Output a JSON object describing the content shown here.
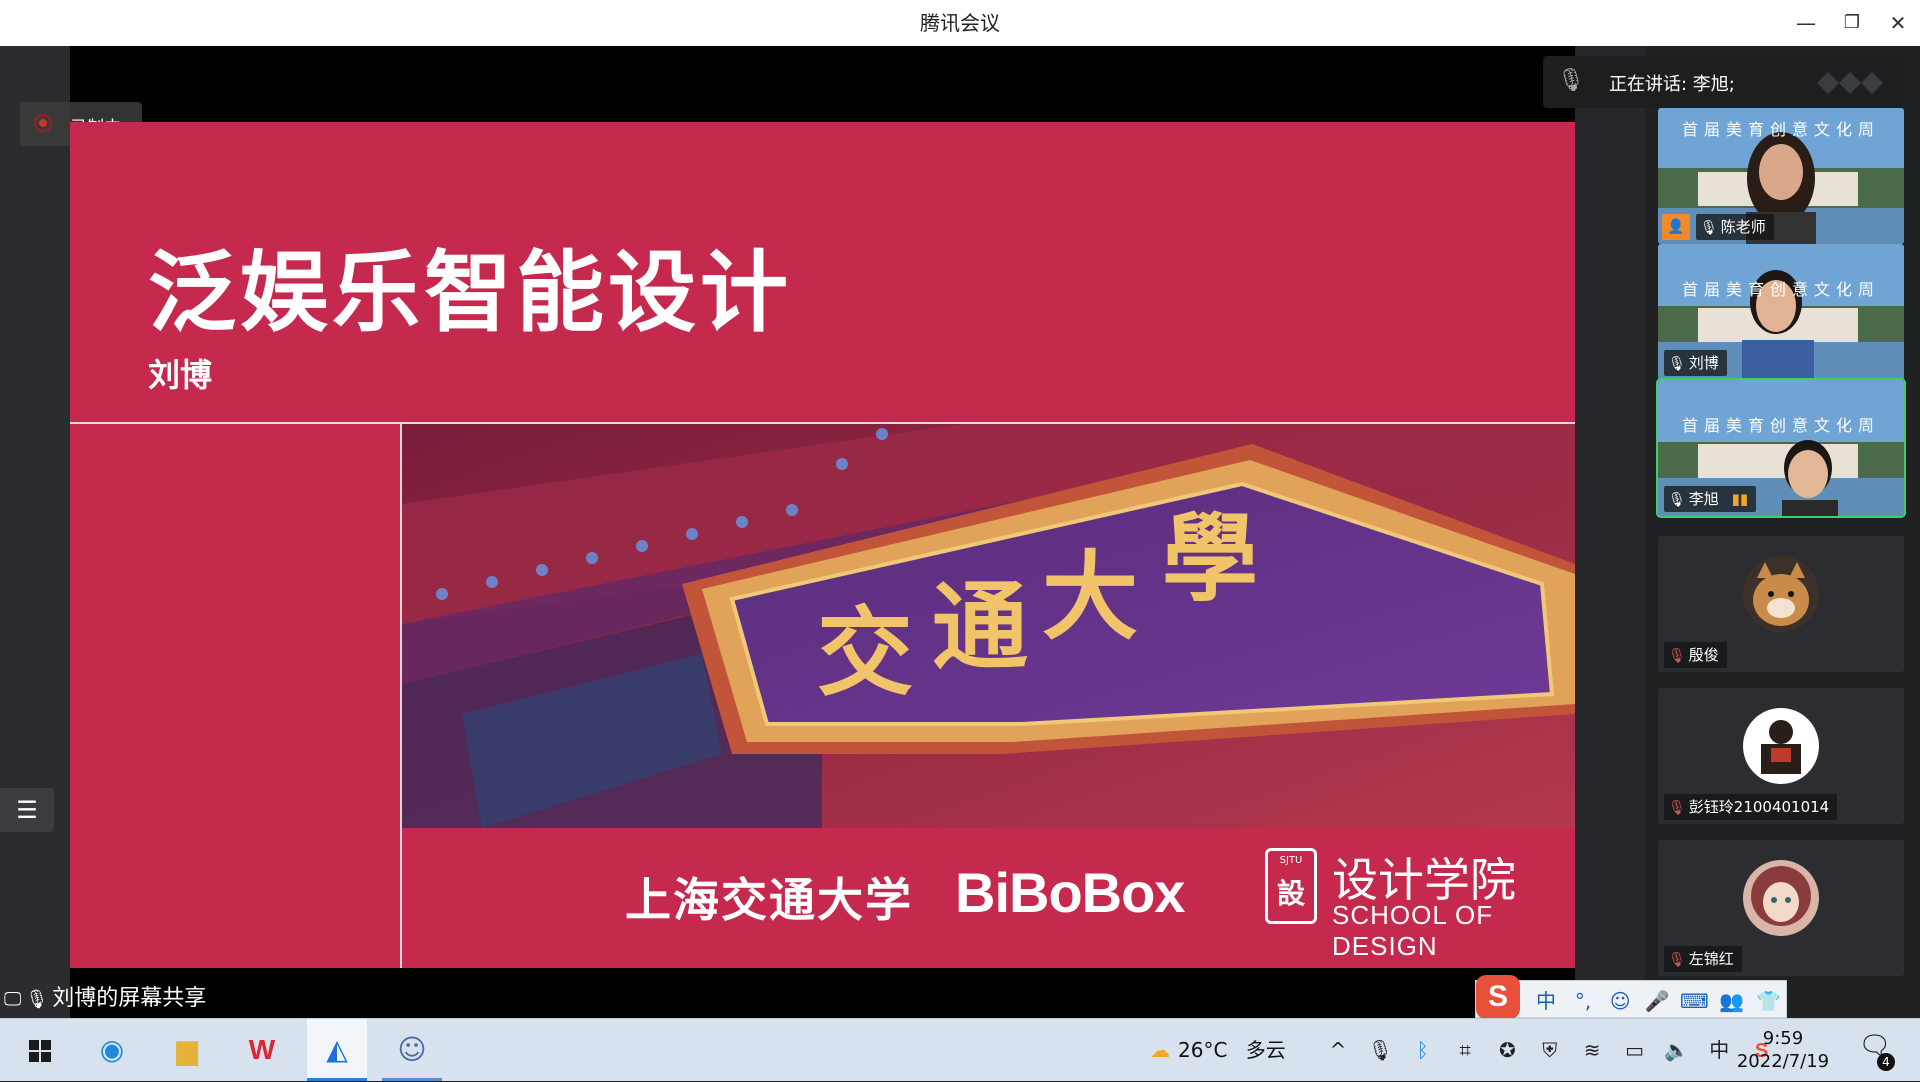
{
  "window": {
    "title": "腾讯会议"
  },
  "recording": {
    "label": "录制中"
  },
  "slide": {
    "title": "泛娱乐智能设计",
    "author": "刘博",
    "plaque_chars": [
      "交",
      "通",
      "大",
      "學"
    ],
    "logo_sjtu": "上海交通大学",
    "logo_bibobox": "BiBoBox",
    "logo_seal_top": "SJTU",
    "logo_seal_mid": "設",
    "logo_design_cn": "设计学院",
    "logo_design_en": "SCHOOL OF DESIGN"
  },
  "share": {
    "label": "刘博的屏幕共享"
  },
  "speaking": {
    "label": "正在讲话: 李旭;"
  },
  "participants": [
    {
      "name": "陈老师",
      "mic": "on",
      "type": "video"
    },
    {
      "name": "刘博",
      "mic": "on",
      "type": "video"
    },
    {
      "name": "李旭",
      "mic": "on",
      "type": "video",
      "active": true
    },
    {
      "name": "殷俊",
      "mic": "off",
      "type": "avatar"
    },
    {
      "name": "彭钰玲2100401014",
      "mic": "off",
      "type": "avatar"
    },
    {
      "name": "左锦红",
      "mic": "off",
      "type": "avatar"
    }
  ],
  "banner_text": "首届美育创意文化周",
  "ime": {
    "items": [
      "中",
      "°,",
      "☺",
      "🎤",
      "⌨",
      "👥",
      "👕",
      "▦"
    ]
  },
  "taskbar": {
    "weather_temp": "26°C",
    "weather_desc": "多云",
    "tray_ime": "中",
    "time": "9:59",
    "date": "2022/7/19",
    "notification_count": "4"
  },
  "colors": {
    "slide_bg": "#c5294d",
    "active_border": "#3ecf6a",
    "plaque_gold": "#f2c46a"
  }
}
